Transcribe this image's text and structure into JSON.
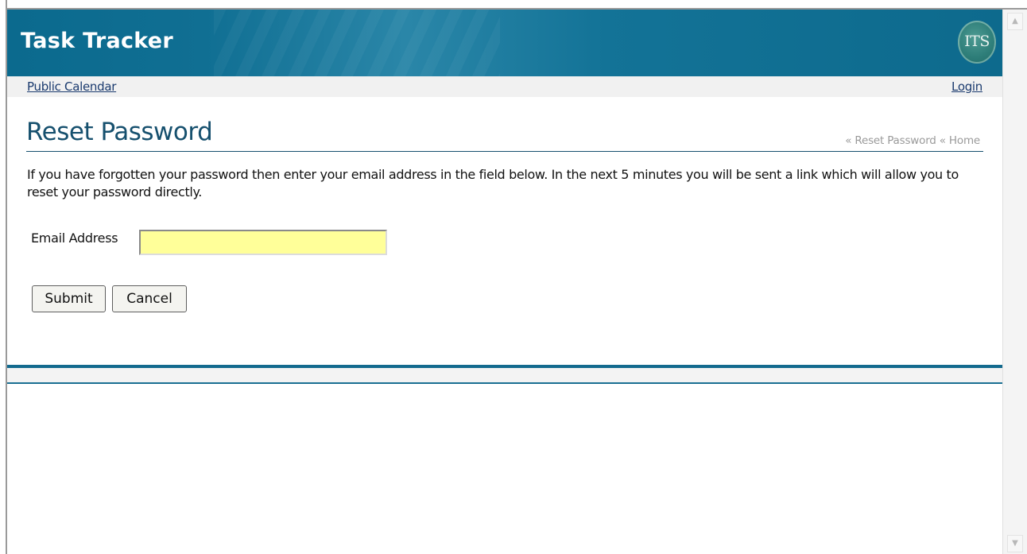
{
  "header": {
    "app_title": "Task Tracker",
    "logo_text": "ITS"
  },
  "nav": {
    "public_calendar": "Public Calendar",
    "login": "Login"
  },
  "page": {
    "title": "Reset Password",
    "breadcrumb": [
      "« Reset Password",
      "« Home"
    ],
    "intro": "If you have forgotten your password then enter your email address in the field below. In the next 5 minutes you will be sent a link which will allow you to reset your password directly."
  },
  "form": {
    "email_label": "Email Address",
    "email_value": "",
    "submit_label": "Submit",
    "cancel_label": "Cancel"
  },
  "scrollbar": {
    "up_icon": "chevron-up-icon",
    "down_icon": "chevron-down-icon"
  },
  "colors": {
    "brand": "#0b6a8e",
    "title": "#16506e",
    "input_background": "#ffff99"
  }
}
